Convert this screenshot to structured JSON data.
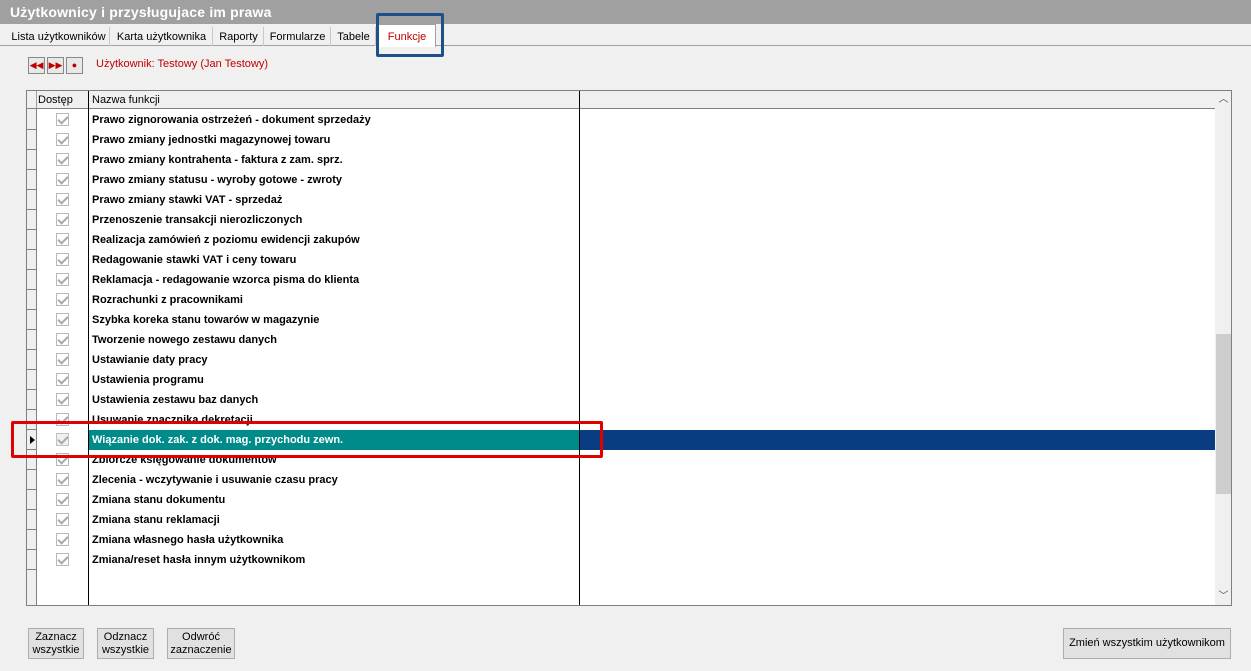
{
  "window": {
    "title": "Użytkownicy i przysługujace im prawa"
  },
  "tabs": [
    {
      "label": "Lista użytkowników"
    },
    {
      "label": "Karta użytkownika"
    },
    {
      "label": "Raporty"
    },
    {
      "label": "Formularze"
    },
    {
      "label": "Tabele"
    },
    {
      "label": "Funkcje",
      "active": true
    }
  ],
  "nav": {
    "first_icon": "rewind-icon",
    "next_icon": "fast-forward-icon",
    "record_icon": "record-icon",
    "user_label": "Użytkownik: Testowy  (Jan Testowy)"
  },
  "grid": {
    "headers": {
      "access": "Dostęp",
      "function_name": "Nazwa funkcji"
    },
    "rows": [
      {
        "name": "Prawo zignorowania ostrzeżeń - dokument sprzedaży",
        "checked": true
      },
      {
        "name": "Prawo zmiany jednostki magazynowej towaru",
        "checked": true
      },
      {
        "name": "Prawo zmiany kontrahenta - faktura z zam. sprz.",
        "checked": true
      },
      {
        "name": "Prawo zmiany statusu - wyroby gotowe - zwroty",
        "checked": true
      },
      {
        "name": "Prawo zmiany stawki VAT - sprzedaż",
        "checked": true
      },
      {
        "name": "Przenoszenie transakcji nierozliczonych",
        "checked": true
      },
      {
        "name": "Realizacja zamówień z poziomu ewidencji zakupów",
        "checked": true
      },
      {
        "name": "Redagowanie stawki VAT i ceny towaru",
        "checked": true
      },
      {
        "name": "Reklamacja - redagowanie wzorca pisma do klienta",
        "checked": true
      },
      {
        "name": "Rozrachunki z pracownikami",
        "checked": true
      },
      {
        "name": "Szybka koreka stanu towarów w magazynie",
        "checked": true
      },
      {
        "name": "Tworzenie nowego zestawu danych",
        "checked": true
      },
      {
        "name": "Ustawianie daty pracy",
        "checked": true
      },
      {
        "name": "Ustawienia programu",
        "checked": true
      },
      {
        "name": "Ustawienia zestawu baz danych",
        "checked": true
      },
      {
        "name": "Usuwanie znacznika dekretacji",
        "checked": true
      },
      {
        "name": "Wiązanie dok. zak. z dok. mag. przychodu zewn.",
        "checked": true,
        "selected": true
      },
      {
        "name": "Zbiorcze księgowanie dokumentów",
        "checked": true
      },
      {
        "name": "Zlecenia - wczytywanie i usuwanie czasu pracy",
        "checked": true
      },
      {
        "name": "Zmiana stanu dokumentu",
        "checked": true
      },
      {
        "name": "Zmiana stanu reklamacji",
        "checked": true
      },
      {
        "name": "Zmiana własnego  hasła  użytkownika",
        "checked": true
      },
      {
        "name": "Zmiana/reset  hasła innym użytkownikom",
        "checked": true
      }
    ]
  },
  "buttons": {
    "select_all_line1": "Zaznacz",
    "select_all_line2": "wszystkie",
    "deselect_all_line1": "Odznacz",
    "deselect_all_line2": "wszystkie",
    "invert_line1": "Odwróć",
    "invert_line2": "zaznaczenie",
    "change_all": "Zmień wszystkim użytkownikom"
  }
}
